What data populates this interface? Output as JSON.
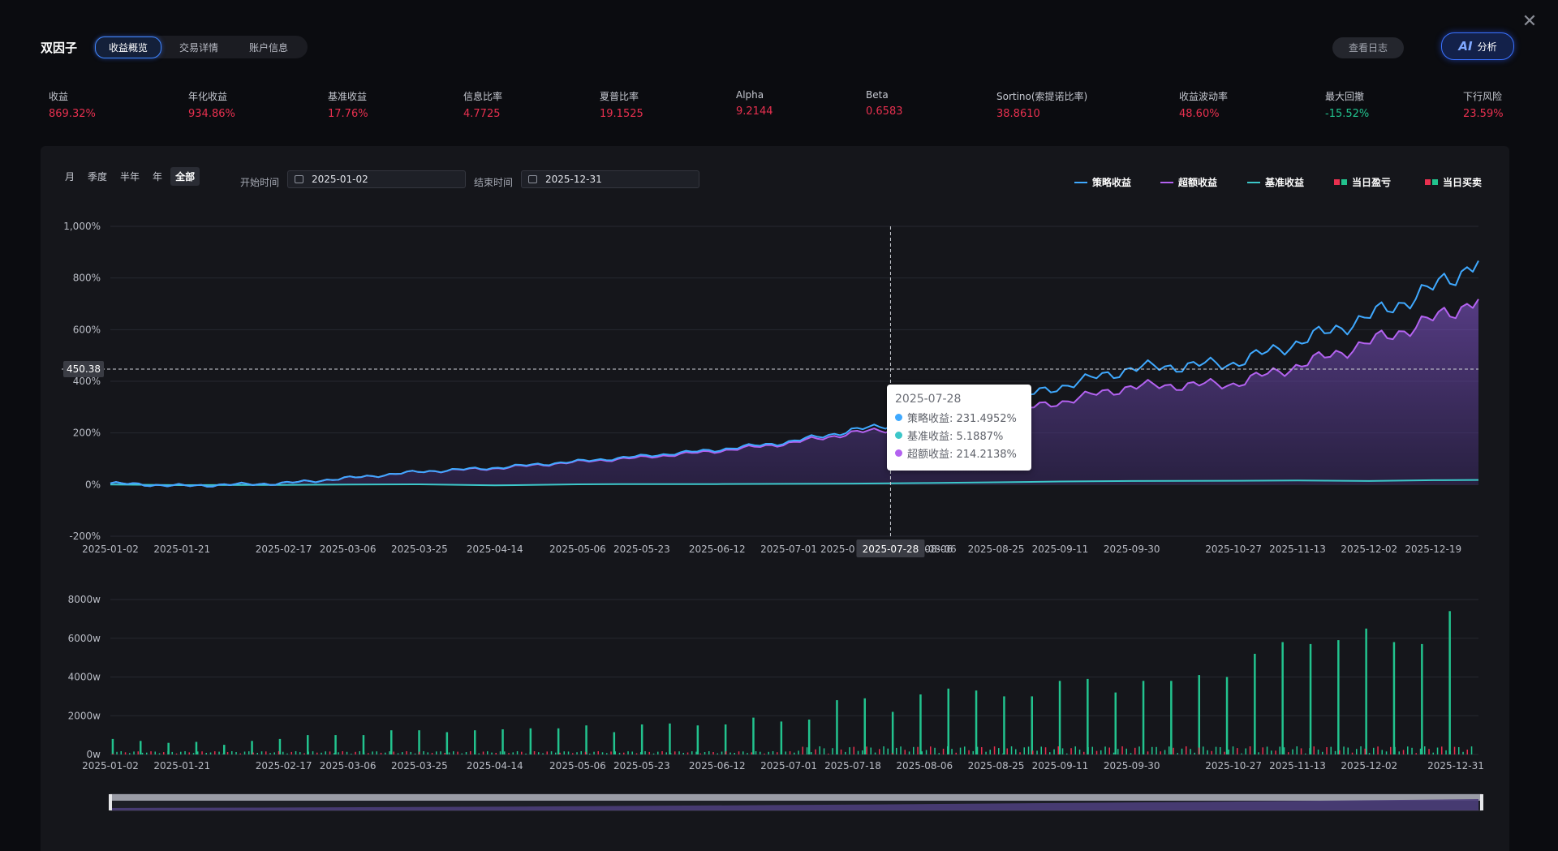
{
  "header": {
    "brand": "双因子",
    "tabs": [
      {
        "label": "收益概览",
        "active": true
      },
      {
        "label": "交易详情",
        "active": false
      },
      {
        "label": "账户信息",
        "active": false
      }
    ],
    "log_button": "查看日志",
    "ai_button": {
      "mark": "AI",
      "label": "分析"
    },
    "close_icon": "close-icon"
  },
  "metrics": [
    {
      "label": "收益",
      "value": "869.32%",
      "color": "#e8304f"
    },
    {
      "label": "年化收益",
      "value": "934.86%",
      "color": "#e8304f"
    },
    {
      "label": "基准收益",
      "value": "17.76%",
      "color": "#e8304f"
    },
    {
      "label": "信息比率",
      "value": "4.7725",
      "color": "#e8304f"
    },
    {
      "label": "夏普比率",
      "value": "19.1525",
      "color": "#e8304f"
    },
    {
      "label": "Alpha",
      "value": "9.2144",
      "color": "#e8304f"
    },
    {
      "label": "Beta",
      "value": "0.6583",
      "color": "#e8304f"
    },
    {
      "label": "Sortino(索提诺比率)",
      "value": "38.8610",
      "color": "#e8304f"
    },
    {
      "label": "收益波动率",
      "value": "48.60%",
      "color": "#e8304f"
    },
    {
      "label": "最大回撤",
      "value": "-15.52%",
      "color": "#22c38e"
    },
    {
      "label": "下行风险",
      "value": "23.59%",
      "color": "#e8304f"
    }
  ],
  "controls": {
    "periods": [
      {
        "label": "月",
        "active": false
      },
      {
        "label": "季度",
        "active": false
      },
      {
        "label": "半年",
        "active": false
      },
      {
        "label": "年",
        "active": false
      },
      {
        "label": "全部",
        "active": true
      }
    ],
    "start_label": "开始时间",
    "start_value": "2025-01-02",
    "end_label": "结束时间",
    "end_value": "2025-12-31"
  },
  "legend": [
    {
      "label": "策略收益",
      "kind": "line",
      "color": "#3fa9ff"
    },
    {
      "label": "超额收益",
      "kind": "line",
      "color": "#b362f0"
    },
    {
      "label": "基准收益",
      "kind": "line",
      "color": "#3cc7c9"
    },
    {
      "label": "当日盈亏",
      "kind": "squares",
      "colors": [
        "#e8304f",
        "#22c38e"
      ]
    },
    {
      "label": "当日买卖",
      "kind": "squares",
      "colors": [
        "#e8304f",
        "#22c38e"
      ]
    }
  ],
  "chart_data": [
    {
      "type": "line",
      "ylim": [
        -200,
        1000
      ],
      "y_ticks": [
        "-200%",
        "0%",
        "200%",
        "400%",
        "600%",
        "800%",
        "1,000%"
      ],
      "x_ticks": [
        "2025-01-02",
        "2025-01-21",
        "2025-02-17",
        "2025-03-06",
        "2025-03-25",
        "2025-04-14",
        "2025-05-06",
        "2025-05-23",
        "2025-06-12",
        "2025-07-01",
        "2025-07-18",
        "2025-08-06",
        "2025-08-25",
        "2025-09-11",
        "2025-09-30",
        "2025-10-27",
        "2025-11-13",
        "2025-12-02",
        "2025-12-19"
      ],
      "x": [
        "2025-01-02",
        "2025-01-21",
        "2025-02-17",
        "2025-03-06",
        "2025-03-25",
        "2025-04-14",
        "2025-05-06",
        "2025-05-23",
        "2025-06-12",
        "2025-07-01",
        "2025-07-18",
        "2025-07-28",
        "2025-08-06",
        "2025-08-25",
        "2025-09-11",
        "2025-09-30",
        "2025-10-27",
        "2025-11-13",
        "2025-12-02",
        "2025-12-19",
        "2025-12-31"
      ],
      "series": [
        {
          "name": "策略收益",
          "color": "#3fa9ff",
          "values": [
            5,
            -5,
            5,
            25,
            50,
            65,
            90,
            110,
            135,
            165,
            210,
            231.5,
            260,
            310,
            380,
            450,
            470,
            550,
            650,
            760,
            869
          ]
        },
        {
          "name": "超额收益",
          "color": "#b362f0",
          "values": [
            5,
            -5,
            5,
            25,
            50,
            63,
            88,
            105,
            130,
            160,
            200,
            214.2,
            235,
            270,
            320,
            380,
            390,
            460,
            550,
            640,
            720
          ]
        },
        {
          "name": "基准收益",
          "color": "#3cc7c9",
          "values": [
            0,
            -2,
            -1,
            0,
            1,
            -3,
            1,
            2,
            2,
            3,
            4,
            5.2,
            6,
            9,
            12,
            14,
            15,
            16,
            14,
            17,
            18
          ]
        }
      ],
      "crosshair": {
        "x": "2025-07-28",
        "y_label": "450.38"
      },
      "tooltip": {
        "date": "2025-07-28",
        "rows": [
          {
            "text": "策略收益: 231.4952%",
            "color": "#3fa9ff"
          },
          {
            "text": "基准收益: 5.1887%",
            "color": "#3cc7c9"
          },
          {
            "text": "超额收益: 214.2138%",
            "color": "#b362f0"
          }
        ]
      }
    },
    {
      "type": "bar",
      "ylim": [
        0,
        8000
      ],
      "y_ticks": [
        "0w",
        "2000w",
        "4000w",
        "6000w",
        "8000w"
      ],
      "x_ticks": [
        "2025-01-02",
        "2025-01-21",
        "2025-02-17",
        "2025-03-06",
        "2025-03-25",
        "2025-04-14",
        "2025-05-06",
        "2025-05-23",
        "2025-06-12",
        "2025-07-01",
        "2025-07-18",
        "2025-08-06",
        "2025-08-25",
        "2025-09-11",
        "2025-09-30",
        "2025-10-27",
        "2025-11-13",
        "2025-12-02",
        "2025-12-31"
      ],
      "series": [
        {
          "name": "当日买卖",
          "color": "#22c38e",
          "values": [
            800,
            700,
            600,
            650,
            500,
            700,
            800,
            1000,
            1000,
            1000,
            1250,
            1250,
            1150,
            1250,
            1300,
            1350,
            1350,
            1500,
            1150,
            1550,
            1600,
            1500,
            1550,
            1900,
            1700,
            1800,
            2800,
            2900,
            2200,
            3100,
            3400,
            3300,
            3000,
            3000,
            3800,
            3900,
            3200,
            3800,
            3800,
            4100,
            4000,
            5200,
            5800,
            5700,
            5900,
            6500,
            5800,
            5700,
            7400
          ]
        }
      ]
    }
  ]
}
